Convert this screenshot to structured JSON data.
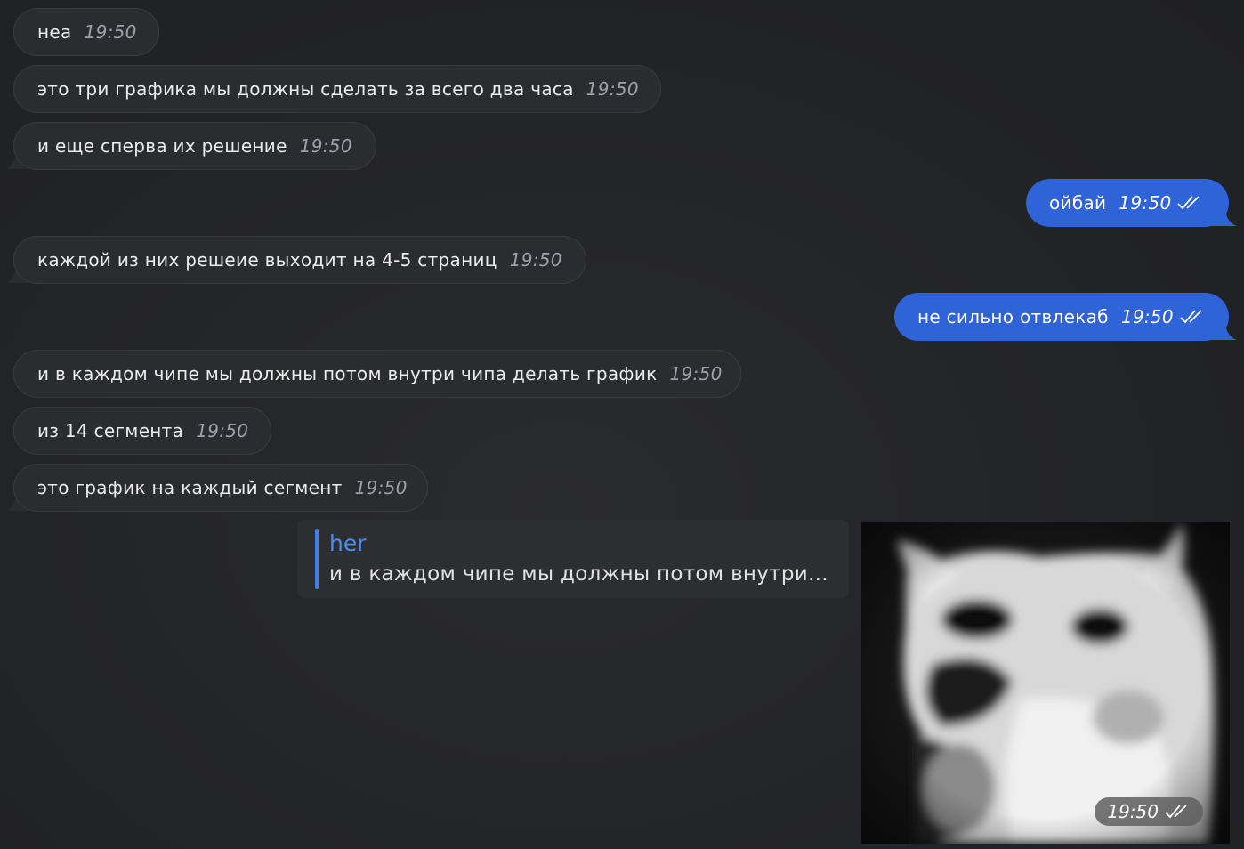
{
  "messages": [
    {
      "dir": "in",
      "text": "неа",
      "time": "19:50"
    },
    {
      "dir": "in",
      "text": "это три графика мы должны сделать за всего два часа",
      "time": "19:50"
    },
    {
      "dir": "in",
      "text": "и еще сперва их решение",
      "time": "19:50"
    },
    {
      "dir": "out",
      "text": "ойбай",
      "time": "19:50"
    },
    {
      "dir": "in",
      "text": "каждой из них решеие выходит на 4-5 страниц",
      "time": "19:50"
    },
    {
      "dir": "out",
      "text": "не сильно отвлекаб",
      "time": "19:50"
    },
    {
      "dir": "in",
      "text": "и в каждом чипе мы должны потом внутри чипа делать график",
      "time": "19:50"
    },
    {
      "dir": "in",
      "text": "из 14 сегмента",
      "time": "19:50"
    },
    {
      "dir": "in",
      "text": "это график на каждый сегмент",
      "time": "19:50"
    }
  ],
  "reply": {
    "author": "her",
    "text": "и в каждом чипе мы должны потом внутри..."
  },
  "photo_message": {
    "time": "19:50"
  },
  "colors": {
    "background": "#232427",
    "incoming_bubble": "#2b2c2f",
    "outgoing_bubble": "#2f63d8",
    "reply_accent": "#3f7ff0"
  }
}
